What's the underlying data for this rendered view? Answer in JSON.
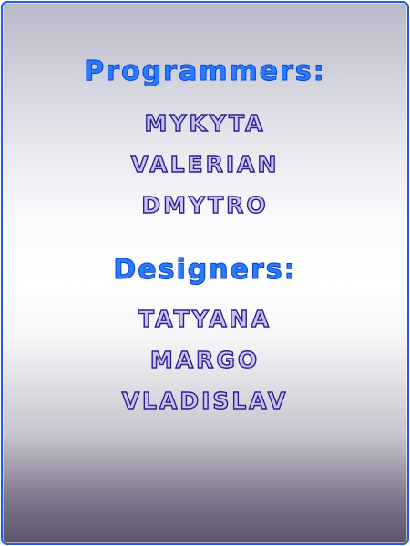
{
  "credits": {
    "programmers_heading": "Programmers:",
    "programmers": [
      "MYKYTA",
      "VALERIAN",
      "DMYTRO"
    ],
    "designers_heading": "Designers:",
    "designers": [
      "TATYANA",
      "MARGO",
      "VLADISLAV"
    ]
  },
  "colors": {
    "border": "#1f5fe0",
    "heading": "#2a7cff",
    "name_fill": "#c9c2f2",
    "name_outline": "#2b1f8c"
  }
}
